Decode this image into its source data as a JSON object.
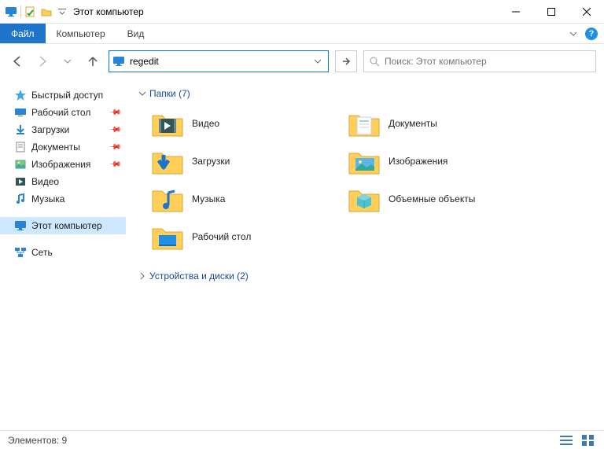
{
  "window": {
    "title": "Этот компьютер"
  },
  "ribbon": {
    "file": "Файл",
    "tabs": [
      "Компьютер",
      "Вид"
    ]
  },
  "address": {
    "value": "regedit"
  },
  "search": {
    "placeholder": "Поиск: Этот компьютер"
  },
  "sidebar": {
    "quick_access": "Быстрый доступ",
    "items": [
      {
        "label": "Рабочий стол",
        "pinned": true
      },
      {
        "label": "Загрузки",
        "pinned": true
      },
      {
        "label": "Документы",
        "pinned": true
      },
      {
        "label": "Изображения",
        "pinned": true
      },
      {
        "label": "Видео",
        "pinned": false
      },
      {
        "label": "Музыка",
        "pinned": false
      }
    ],
    "this_pc": "Этот компьютер",
    "network": "Сеть"
  },
  "content": {
    "folders_header": "Папки (7)",
    "devices_header": "Устройства и диски (2)",
    "folders": [
      {
        "label": "Видео"
      },
      {
        "label": "Документы"
      },
      {
        "label": "Загрузки"
      },
      {
        "label": "Изображения"
      },
      {
        "label": "Музыка"
      },
      {
        "label": "Объемные объекты"
      },
      {
        "label": "Рабочий стол"
      }
    ]
  },
  "statusbar": {
    "items": "Элементов: 9"
  },
  "icons": {
    "monitor": "monitor-icon",
    "check": "check-icon",
    "dropdown": "dropdown-icon",
    "minimize": "minimize-icon",
    "maximize": "maximize-icon",
    "close": "close-icon",
    "chevron_down": "chevron-down",
    "help": "?",
    "back": "back-arrow",
    "forward": "forward-arrow",
    "up": "up-arrow",
    "go": "arrow-right",
    "search": "search-icon",
    "star": "star-icon",
    "pin": "pin-icon"
  },
  "colors": {
    "accent": "#1e74c9",
    "selection": "#cde8ff",
    "folder": "#ffcf5a",
    "link": "#16499c"
  }
}
